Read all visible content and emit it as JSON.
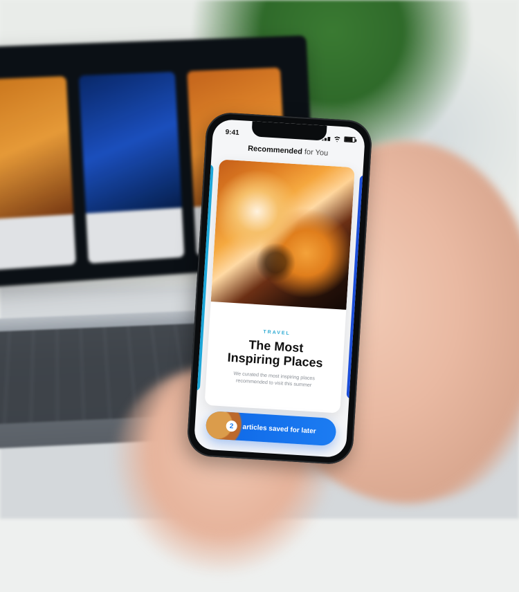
{
  "statusbar": {
    "time": "9:41"
  },
  "header": {
    "bold": "Recommended",
    "light": " for You"
  },
  "card": {
    "kicker": "TRAVEL",
    "headline_line1": "The Most",
    "headline_line2": "Inspiring Places",
    "sub": "We curated the most inspiring places recommended to visit this summer"
  },
  "pill": {
    "count": "2",
    "label": "articles saved for later"
  }
}
